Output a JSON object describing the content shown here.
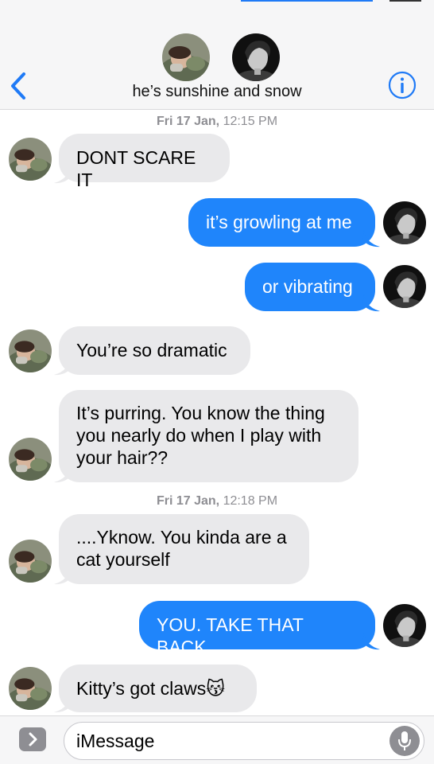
{
  "header": {
    "title": "he’s sunshine and snow",
    "back_icon": "chevron-left-icon",
    "info_icon": "info-icon",
    "accent_color": "#1f7af6"
  },
  "messages": {
    "timestamp_1": {
      "day": "Fri 17 Jan,",
      "time": "12:15 PM"
    },
    "m1": "DONT SCARE IT",
    "m2": "it’s growling at me",
    "m3": "or vibrating",
    "m4": "You’re so dramatic",
    "m5_line1": "It’s purring. You know the thing",
    "m5_line2": "you nearly do when I play with",
    "m5_line3": "your hair??",
    "timestamp_2": {
      "day": "Fri 17 Jan,",
      "time": "12:18 PM"
    },
    "m6_line1": "....Yknow. You kinda are a",
    "m6_line2": "cat yourself",
    "m7": "YOU. TAKE THAT BACK.",
    "m8": "Kitty’s got claws",
    "m8_emoji": "😽",
    "incoming_color": "#e9e9eb",
    "outgoing_color": "#1f85fb"
  },
  "input": {
    "placeholder": "iMessage",
    "apps_icon": "chevron-right-icon",
    "mic_icon": "microphone-icon"
  }
}
